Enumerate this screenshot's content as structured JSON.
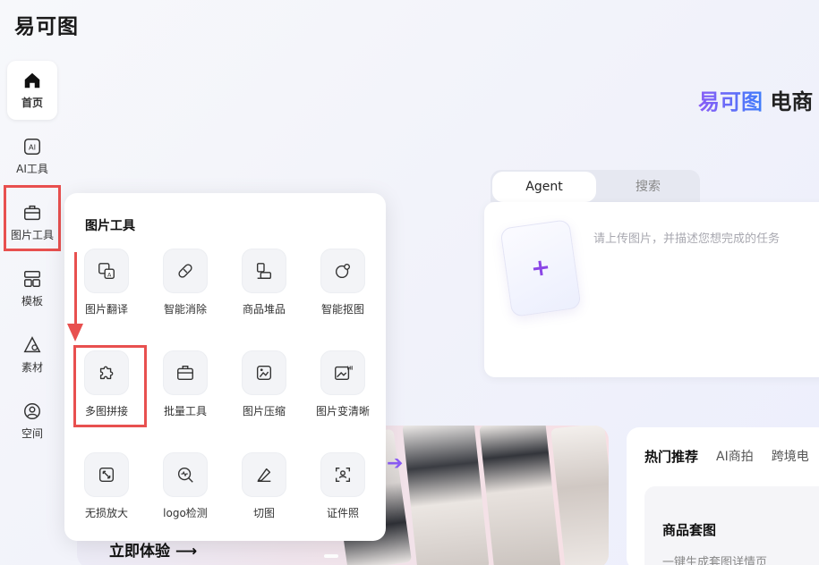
{
  "app": {
    "logo": "易可图"
  },
  "sidebar": {
    "items": [
      {
        "label": "首页",
        "icon": "home-icon"
      },
      {
        "label": "AI工具",
        "icon": "ai-icon"
      },
      {
        "label": "图片工具",
        "icon": "toolbox-icon"
      },
      {
        "label": "模板",
        "icon": "template-icon"
      },
      {
        "label": "素材",
        "icon": "material-icon"
      },
      {
        "label": "空间",
        "icon": "user-space-icon"
      }
    ],
    "active": "首页"
  },
  "hero": {
    "brand": "易可图",
    "title_rest": "电商"
  },
  "task": {
    "tabs": [
      "Agent",
      "搜索"
    ],
    "active_tab": "Agent",
    "upload_symbol": "+",
    "placeholder": "请上传图片，并描述您想完成的任务"
  },
  "popup": {
    "title": "图片工具",
    "tools": [
      {
        "label": "图片翻译",
        "icon": "image-translate-icon"
      },
      {
        "label": "智能消除",
        "icon": "eraser-bandage-icon"
      },
      {
        "label": "商品堆品",
        "icon": "product-stack-icon"
      },
      {
        "label": "智能抠图",
        "icon": "cutout-icon"
      },
      {
        "label": "多图拼接",
        "icon": "puzzle-icon"
      },
      {
        "label": "批量工具",
        "icon": "batch-toolbox-icon"
      },
      {
        "label": "图片压缩",
        "icon": "image-compress-icon"
      },
      {
        "label": "图片变清晰",
        "icon": "image-hd-icon"
      },
      {
        "label": "无损放大",
        "icon": "lossless-zoom-icon"
      },
      {
        "label": "logo检测",
        "icon": "logo-detect-icon"
      },
      {
        "label": "切图",
        "icon": "slice-knife-icon"
      },
      {
        "label": "证件照",
        "icon": "id-photo-icon"
      }
    ]
  },
  "banner": {
    "cta": "立即体验 ⟶"
  },
  "hot": {
    "tabs": [
      "热门推荐",
      "AI商拍",
      "跨境电"
    ],
    "card_title": "商品套图",
    "card_sub": "一键生成套图详情页"
  },
  "colors": {
    "accent": "#8b46e6",
    "annotation": "#e8504f"
  }
}
